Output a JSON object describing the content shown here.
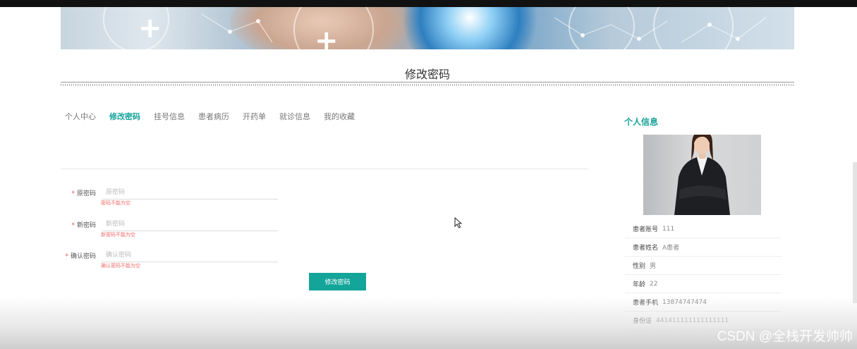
{
  "page": {
    "title": "修改密码"
  },
  "tabs": [
    {
      "label": "个人中心",
      "active": false
    },
    {
      "label": "修改密码",
      "active": true
    },
    {
      "label": "挂号信息",
      "active": false
    },
    {
      "label": "患者病历",
      "active": false
    },
    {
      "label": "开药单",
      "active": false
    },
    {
      "label": "就诊信息",
      "active": false
    },
    {
      "label": "我的收藏",
      "active": false
    }
  ],
  "form": {
    "old_password": {
      "label": "原密码",
      "placeholder": "原密码",
      "error": "密码不能为空"
    },
    "new_password": {
      "label": "新密码",
      "placeholder": "新密码",
      "error": "新密码不能为空"
    },
    "confirm_password": {
      "label": "确认密码",
      "placeholder": "确认密码",
      "error": "确认密码不能为空"
    },
    "submit_label": "修改密码"
  },
  "profile": {
    "title": "个人信息",
    "fields": [
      {
        "key": "患者账号",
        "value": "111"
      },
      {
        "key": "患者姓名",
        "value": "A患者"
      },
      {
        "key": "性别",
        "value": "男"
      },
      {
        "key": "年龄",
        "value": "22"
      },
      {
        "key": "患者手机",
        "value": "13874747474"
      },
      {
        "key": "身份证",
        "value": "441411111111111111"
      }
    ]
  },
  "watermark": "CSDN @全栈开发帅帅",
  "colors": {
    "accent": "#14a59a",
    "error": "#f26b6b"
  }
}
